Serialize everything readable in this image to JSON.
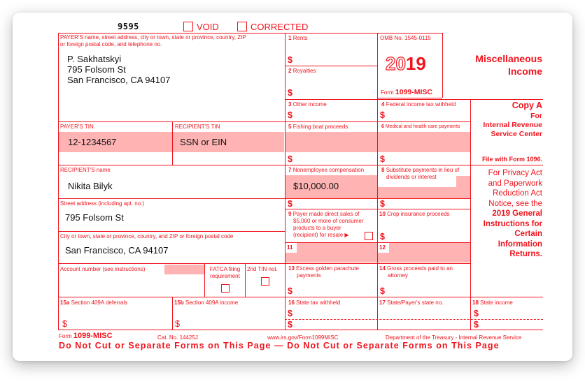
{
  "form": {
    "control_number": "9595",
    "void_label": "VOID",
    "corrected_label": "CORRECTED",
    "omb": "OMB No. 1545-0115",
    "year_outline": "20",
    "year_bold": "19",
    "form_word": "Form",
    "form_name": "1099-MISC",
    "title_line1": "Miscellaneous",
    "title_line2": "Income",
    "colors": {
      "accent": "#f0141e",
      "fill": "#ffb3b3"
    }
  },
  "payer": {
    "label": "PAYER'S name, street address, city or town, state or province, country, ZIP",
    "label2": "or foreign postal code, and telephone no.",
    "name": "P. Sakhatskyi",
    "street": "795 Folsom St",
    "city": "San Francisco, CA 94107",
    "tin_label": "PAYER'S TIN",
    "tin": "12-1234567"
  },
  "recipient": {
    "tin_label": "RECIPIENT'S TIN",
    "tin": "SSN or EIN",
    "name_label": "RECIPIENT'S name",
    "name": "Nikita Bilyk",
    "street_label": "Street address (including apt. no.)",
    "street": "795 Folsom St",
    "city_label": "City or town, state or province, country, and ZIP or foreign postal code",
    "city": "San Francisco, CA 94107",
    "account_label": "Account number (see instructions)",
    "fatca_label1": "FATCA filing",
    "fatca_label2": "requirement",
    "tin_not_label": "2nd TIN not."
  },
  "boxes": {
    "dollar": "$",
    "b1_num": "1",
    "b1_label": "Rents",
    "b2_num": "2",
    "b2_label": "Royalties",
    "b3_num": "3",
    "b3_label": "Other income",
    "b4_num": "4",
    "b4_label": "Federal income tax withheld",
    "b5_num": "5",
    "b5_label": "Fishing boat proceeds",
    "b6_num": "6",
    "b6_label": "Medical and health care payments",
    "b7_num": "7",
    "b7_label": "Nonemployee compensation",
    "b7_value": "$10,000.00",
    "b8_num": "8",
    "b8_label1": "Substitute payments in lieu of",
    "b8_label2": "dividends or interest",
    "b9_num": "9",
    "b9_label1": "Payer made direct sales of",
    "b9_label2": "$5,000 or more of consumer",
    "b9_label3": "products to a buyer",
    "b9_label4": "(recipient) for resale ▶",
    "b10_num": "10",
    "b10_label": "Crop insurance proceeds",
    "b11_num": "11",
    "b12_num": "12",
    "b13_num": "13",
    "b13_label1": "Excess golden parachute",
    "b13_label2": "payments",
    "b14_num": "14",
    "b14_label1": "Gross proceeds paid to an",
    "b14_label2": "attorney",
    "b15a_num": "15a",
    "b15a_label": "Section 409A deferrals",
    "b15b_num": "15b",
    "b15b_label": "Section 409A income",
    "b16_num": "16",
    "b16_label": "State tax withheld",
    "b17_num": "17",
    "b17_label": "State/Payer's state no.",
    "b18_num": "18",
    "b18_label": "State income"
  },
  "side_panel": {
    "copy": "Copy A",
    "for": "For",
    "irs1": "Internal Revenue",
    "irs2": "Service Center",
    "file_with": "File with Form 1096.",
    "privacy1": "For Privacy Act",
    "privacy2": "and Paperwork",
    "privacy3": "Reduction Act",
    "privacy4": "Notice, see the",
    "instr1": "2019 General",
    "instr2": "Instructions for",
    "instr3": "Certain",
    "instr4": "Information",
    "instr5": "Returns."
  },
  "footer": {
    "form_word": "Form",
    "form_name": "1099-MISC",
    "cat_no": "Cat. No. 14425J",
    "url": "www.irs.gov/Form1099MISC",
    "dept": "Department of the Treasury - Internal Revenue Service",
    "warning": "Do Not Cut or Separate Forms on This Page — Do Not Cut or Separate Forms on This Page"
  }
}
